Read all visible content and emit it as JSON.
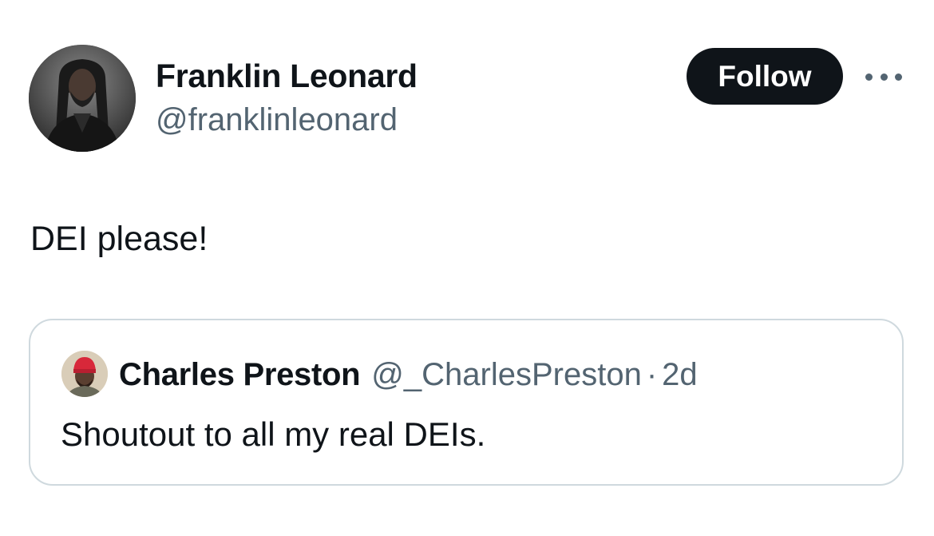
{
  "tweet": {
    "author": {
      "name": "Franklin Leonard",
      "handle": "@franklinleonard",
      "avatar_icon": "user-avatar-photo"
    },
    "follow_label": "Follow",
    "more_icon": "more-horizontal-icon",
    "text": "DEI please!",
    "quote": {
      "author": {
        "name": "Charles Preston",
        "handle": "@_CharlesPreston",
        "avatar_icon": "user-avatar-photo"
      },
      "separator": "·",
      "time": "2d",
      "text": "Shoutout to all my real DEIs."
    }
  },
  "colors": {
    "text_primary": "#0f1419",
    "text_secondary": "#536471",
    "border": "#cfd9de",
    "follow_bg": "#0f1419",
    "follow_text": "#ffffff"
  }
}
